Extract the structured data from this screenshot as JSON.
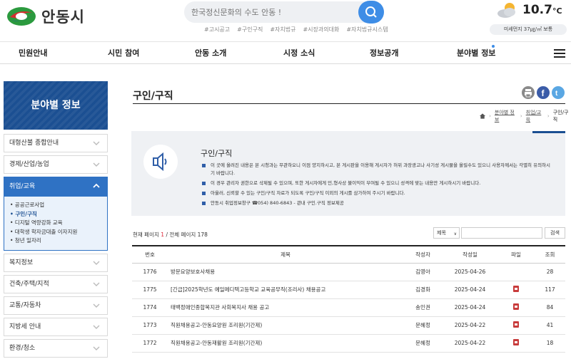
{
  "header": {
    "logo_text": "안동시",
    "search_placeholder": "한국정신문화의 수도 안동 !",
    "tags": [
      "#고시공고",
      "#구인구직",
      "#자치법규",
      "#시장과의대화",
      "#자치법규시스템"
    ],
    "weather": {
      "temp": "10.7",
      "unit": "°C",
      "dust": "미세먼지 37㎍/㎥ 보통"
    }
  },
  "gnb": [
    "민원안내",
    "시민 참여",
    "안동 소개",
    "시정 소식",
    "정보공개",
    "분야별 정보"
  ],
  "side": {
    "title": "분야별 정보",
    "items_top": [
      "대형산불 종합안내",
      "경제/산업/농업"
    ],
    "active": "취업/교육",
    "sub": [
      "• 공공근로사업",
      "• 구인/구직",
      "• 디지털 역량강화 교육",
      "• 대학생 학자금대출 이자지원",
      "• 청년 일자리"
    ],
    "items_bottom": [
      "복지정보",
      "건축/주택/지적",
      "교통/자동차",
      "지방세 안내",
      "환경/청소"
    ]
  },
  "content": {
    "title": "구인/구직",
    "breadcrumb": [
      "분야별 정보",
      "취업/교육",
      "구인/구직"
    ],
    "notice": {
      "title": "구인/구직",
      "items": [
        "이 곳에 올려진 내용은 본 시청과는 무관하오니 이점 양지하시고, 본 게시판을 이용해 게시자가 허위 과장광고나 사기성 게시물을 올릴수도 있으니 사용자께서는 각별히 유의하시기 바랍니다.",
        "이 경우 관리자 권한으로 삭제될 수 있으며, 또한 게시자에게 민,형사상 불이익이 부여될 수 있으니 성격에 맞는 내용만 게시하시기 바랍니다.",
        "아울러, 신뢰할 수 있는 구인/구직 자료가 되도록 구인/구직 이외의 게시를 삼가하여 주시기 바랍니다.",
        "안동시 취업정보창구 ☎054) 840-6843 - 관내 구인.구직 정보제공"
      ]
    },
    "page_info": {
      "prefix": "현재 페이지 ",
      "current": "1",
      "suffix": " / 전체 페이지 178"
    },
    "search": {
      "select": "제목",
      "button": "검색"
    },
    "table": {
      "headers": [
        "번호",
        "제목",
        "작성자",
        "작성일",
        "파일",
        "조회"
      ],
      "rows": [
        {
          "no": "1776",
          "title": "방문요양보호사채용",
          "author": "김영아",
          "date": "2025-04-26",
          "file": false,
          "views": "28"
        },
        {
          "no": "1775",
          "title": "[긴급]2025학년도 예일메디텍고등학교 교육공무직(조리사) 채용공고",
          "author": "김경화",
          "date": "2025-04-24",
          "file": true,
          "views": "117"
        },
        {
          "no": "1774",
          "title": "태백정애인종합복지관 사회복지사 채용 공고",
          "author": "송인권",
          "date": "2025-04-24",
          "file": true,
          "views": "84"
        },
        {
          "no": "1773",
          "title": "직원채용공고-안동요양원 조리원(기간제)",
          "author": "문혜정",
          "date": "2025-04-22",
          "file": true,
          "views": "41"
        },
        {
          "no": "1772",
          "title": "직원채용공고-안동재활원 조리원(기간제)",
          "author": "문혜정",
          "date": "2025-04-22",
          "file": true,
          "views": "18"
        }
      ]
    }
  }
}
